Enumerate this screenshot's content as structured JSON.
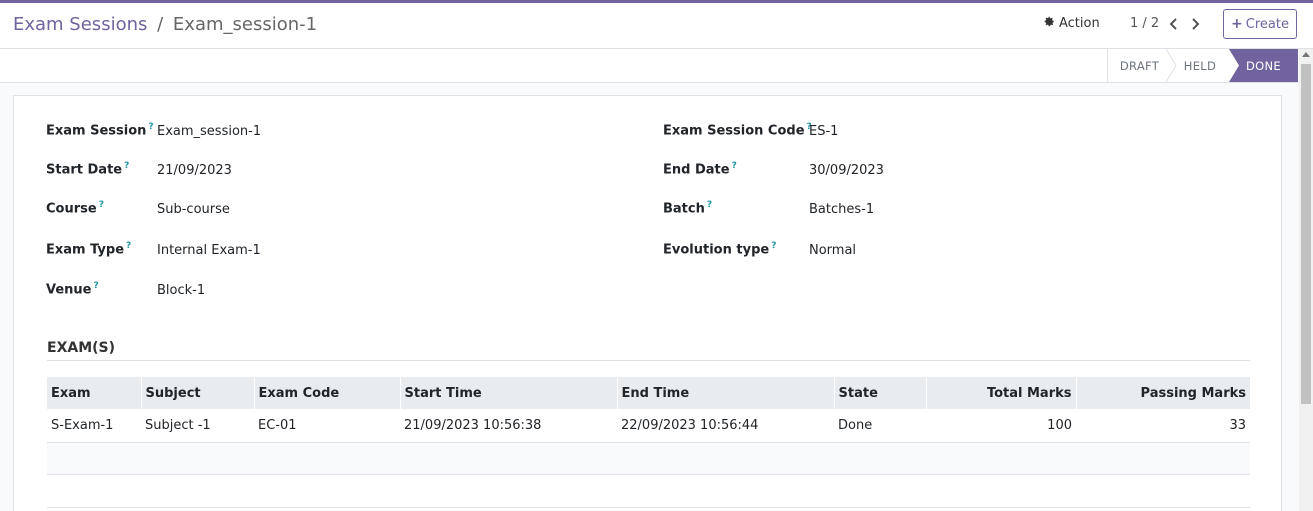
{
  "breadcrumb": {
    "parent": "Exam Sessions",
    "separator": "/",
    "current": "Exam_session-1"
  },
  "toolbar": {
    "action_label": "Action",
    "pager": "1 / 2",
    "create_label": "Create"
  },
  "statusbar": {
    "states": [
      "DRAFT",
      "HELD",
      "DONE"
    ],
    "active": "DONE"
  },
  "form": {
    "exam_session": {
      "label": "Exam Session",
      "value": "Exam_session-1"
    },
    "exam_session_code": {
      "label": "Exam Session Code",
      "value": "ES-1"
    },
    "start_date": {
      "label": "Start Date",
      "value": "21/09/2023"
    },
    "end_date": {
      "label": "End Date",
      "value": "30/09/2023"
    },
    "course": {
      "label": "Course",
      "value": "Sub-course"
    },
    "batch": {
      "label": "Batch",
      "value": "Batches-1"
    },
    "exam_type": {
      "label": "Exam Type",
      "value": "Internal Exam-1"
    },
    "evolution_type": {
      "label": "Evolution type",
      "value": "Normal"
    },
    "venue": {
      "label": "Venue",
      "value": "Block-1"
    },
    "help_marker": "?"
  },
  "exams": {
    "title": "EXAM(S)",
    "columns": [
      "Exam",
      "Subject",
      "Exam Code",
      "Start Time",
      "End Time",
      "State",
      "Total Marks",
      "Passing Marks"
    ],
    "rows": [
      [
        "S-Exam-1",
        "Subject -1",
        "EC-01",
        "21/09/2023 10:56:38",
        "22/09/2023 10:56:44",
        "Done",
        "100",
        "33"
      ]
    ]
  },
  "colors": {
    "brand": "#71639e",
    "help": "#2196a6"
  }
}
